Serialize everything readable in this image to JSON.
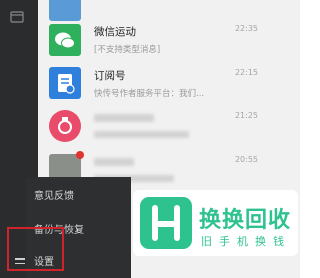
{
  "chats": [
    {
      "name": "微信运动",
      "preview": "[不支持类型消息]",
      "time": "22:35"
    },
    {
      "name": "订阅号",
      "preview": "快传号作者服务平台：我们...",
      "time": "22:15"
    },
    {
      "time": "21:25"
    },
    {
      "time": "20:55"
    }
  ],
  "menu": {
    "items": [
      "意见反馈",
      "备份与恢复",
      "设置"
    ]
  },
  "watermark": {
    "title": "换换回收",
    "subtitle": "旧手机换钱"
  },
  "colors": {
    "sidebar": "#2b2c2e",
    "menu_bg": "#2e2f31",
    "highlight": "#d1232b",
    "brand_green": "#2ec28e"
  }
}
